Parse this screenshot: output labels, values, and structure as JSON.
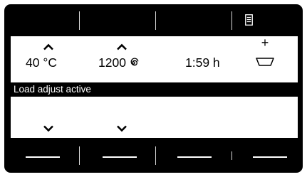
{
  "display": {
    "temperature": "40 °C",
    "spin_speed": "1200",
    "spin_icon": "spin-icon",
    "duration": "1:59 h",
    "extra_control_label": "+",
    "extra_icon": "dispenser-tray-icon",
    "status_message": "Load adjust active"
  },
  "top_keys": {
    "menu_icon": "menu-list-icon"
  },
  "colors": {
    "bezel": "#000000",
    "screen": "#ffffff",
    "status_bar": "#000000",
    "status_text": "#ffffff"
  }
}
